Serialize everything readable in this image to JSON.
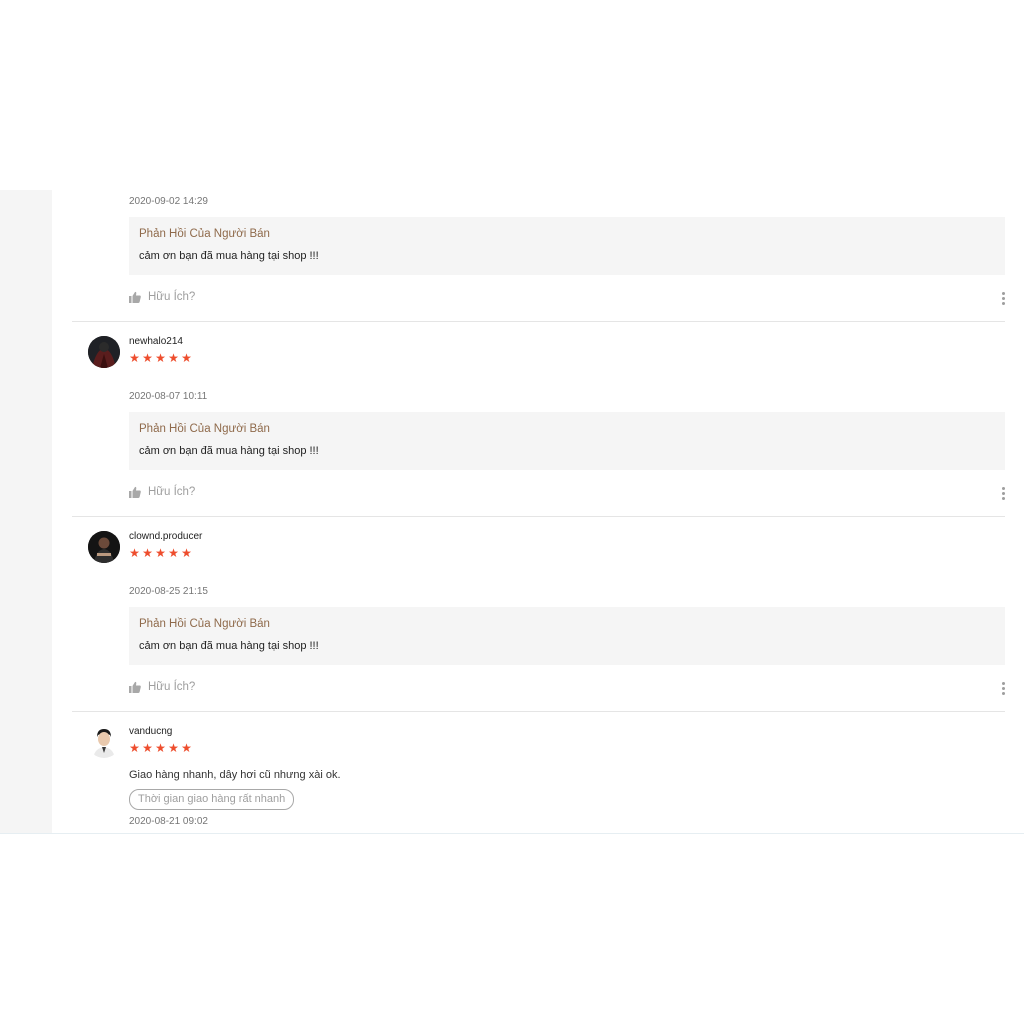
{
  "reviews": [
    {
      "username": "",
      "date": "2020-09-02 14:29",
      "reply_title": "Phản Hồi Của Người Bán",
      "reply_text": "cảm ơn bạn đã mua hàng tại shop !!!",
      "helpful_label": "Hữu Ích?"
    },
    {
      "username": "newhalo214",
      "rating": 5,
      "date": "2020-08-07 10:11",
      "reply_title": "Phản Hồi Của Người Bán",
      "reply_text": "cảm ơn bạn đã mua hàng tại shop !!!",
      "helpful_label": "Hữu Ích?"
    },
    {
      "username": "clownd.producer",
      "rating": 5,
      "date": "2020-08-25 21:15",
      "reply_title": "Phản Hồi Của Người Bán",
      "reply_text": "cảm ơn bạn đã mua hàng tại shop !!!",
      "helpful_label": "Hữu Ích?"
    },
    {
      "username": "vanducng",
      "rating": 5,
      "comment": "Giao hàng nhanh, dây hơi cũ nhưng xài ok.",
      "tag": "Thời gian giao hàng rất nhanh",
      "date": "2020-08-21 09:02"
    }
  ],
  "colors": {
    "star": "#ee4d2d",
    "reply_title": "#8f6a4b",
    "reply_bg": "#f5f5f5",
    "muted": "#9e9e9e"
  },
  "icons": {
    "star": "★",
    "helpful": "thumbs-up-icon",
    "more": "more-vertical-icon"
  }
}
